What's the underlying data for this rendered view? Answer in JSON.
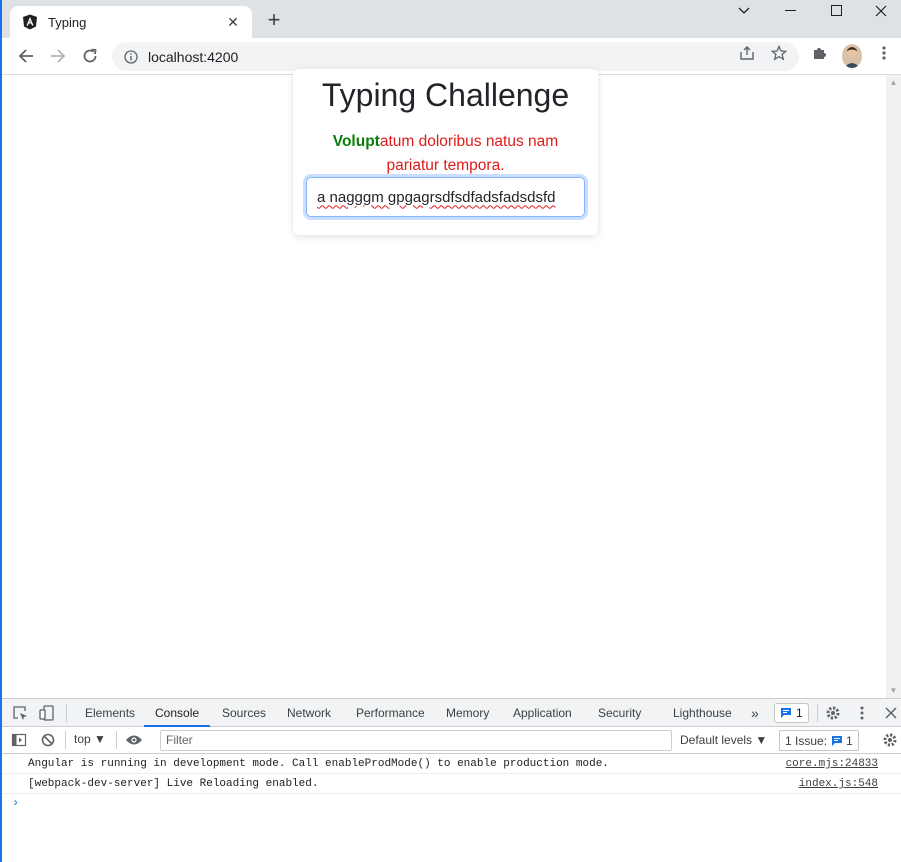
{
  "browser": {
    "tab_title": "Typing",
    "tab_close": "✕",
    "new_tab": "+",
    "url": "localhost:4200"
  },
  "page": {
    "heading": "Typing Challenge",
    "prompt_typed": "Volupt",
    "prompt_remaining": "atum doloribus natus nam pariatur tempora.",
    "input_value": "a nagggm gpgagrsdfsdfadsfadsdsfd"
  },
  "devtools": {
    "tabs": [
      "Elements",
      "Console",
      "Sources",
      "Network",
      "Performance",
      "Memory",
      "Application",
      "Security",
      "Lighthouse"
    ],
    "active_tab": "Console",
    "more_tabs": "»",
    "issues_badge": "1",
    "context": "top",
    "filter_placeholder": "Filter",
    "levels": "Default levels",
    "issue_label": "1 Issue:",
    "issue_count": "1",
    "console": [
      {
        "message": "Angular is running in development mode. Call enableProdMode() to enable production mode.",
        "source": "core.mjs:24833"
      },
      {
        "message": "[webpack-dev-server] Live Reloading enabled.",
        "source": "index.js:548"
      }
    ],
    "prompt_symbol": "›"
  },
  "colors": {
    "typed": "#0a7d0a",
    "remaining": "#e01b1b",
    "accent": "#1a73e8"
  }
}
